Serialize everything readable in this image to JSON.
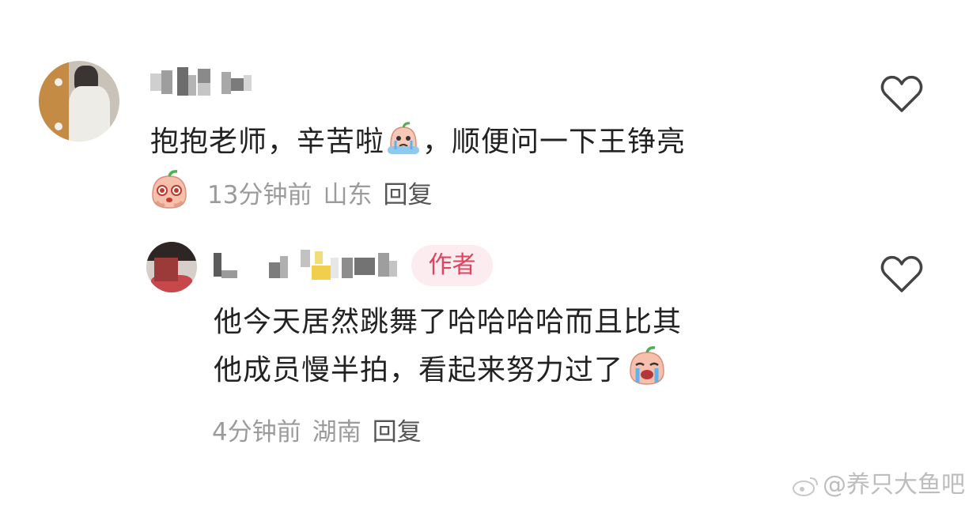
{
  "comments": [
    {
      "text_part1": "抱抱老师，辛苦啦",
      "text_part2": "，顺便问一下王铮亮",
      "time": "13分钟前",
      "location": "山东",
      "reply_label": "回复",
      "inline_emoji": "crying-peach-emoji",
      "reaction_emoji": "teary-peach-emoji"
    },
    {
      "author_badge": "作者",
      "text_line1": "他今天居然跳舞了哈哈哈哈而且比其",
      "text_line2": "他成员慢半拍，看起来努力过了",
      "time": "4分钟前",
      "location": "湖南",
      "reply_label": "回复",
      "inline_emoji": "sobbing-peach-emoji"
    }
  ],
  "watermark": "@养只大鱼吧",
  "icons": {
    "like": "heart-outline-icon",
    "weibo": "weibo-logo-icon"
  },
  "colors": {
    "badge_text": "#e0435c",
    "badge_bg": "#fdecef",
    "meta": "#9b9b9b"
  }
}
